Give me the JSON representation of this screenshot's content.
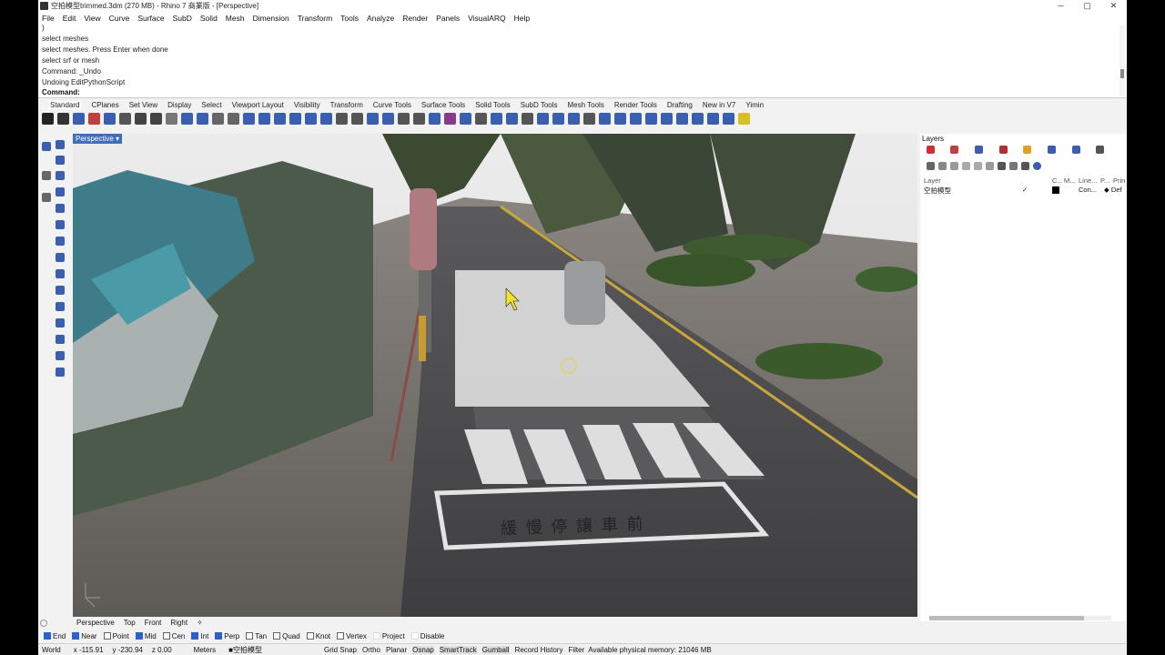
{
  "window": {
    "title": "空拍模型trimmed.3dm (270 MB) - Rhino 7 商業版 - [Perspective]",
    "minimize": "─",
    "maximize": "▢",
    "close": "✕"
  },
  "menu": [
    "File",
    "Edit",
    "View",
    "Curve",
    "Surface",
    "SubD",
    "Solid",
    "Mesh",
    "Dimension",
    "Transform",
    "Tools",
    "Analyze",
    "Render",
    "Panels",
    "VisualARQ",
    "Help"
  ],
  "command_history": [
    ")",
    "select meshes",
    "select meshes. Press Enter when done",
    "select srf or mesh",
    "Command: _Undo",
    "Undoing EditPythonScript"
  ],
  "command_prompt": "Command:",
  "toolbar_tabs": [
    "Standard",
    "CPlanes",
    "Set View",
    "Display",
    "Select",
    "Viewport Layout",
    "Visibility",
    "Transform",
    "Curve Tools",
    "Surface Tools",
    "Solid Tools",
    "SubD Tools",
    "Mesh Tools",
    "Render Tools",
    "Drafting",
    "New in V7",
    "Yimin"
  ],
  "viewport": {
    "label": "Perspective ▾",
    "crosswalk_text": "緩 慢 停 讓 車 前"
  },
  "viewport_tabs": [
    "Perspective",
    "Top",
    "Front",
    "Right",
    "✧"
  ],
  "layers_panel": {
    "title": "Layers",
    "columns": [
      "Layer",
      "C...",
      "M...",
      "Line...",
      "P...",
      "Prin"
    ],
    "rows": [
      {
        "name": "空拍模型",
        "check": "✓",
        "linetype": "Con...",
        "print": "◆ Def"
      }
    ]
  },
  "osnap": [
    {
      "label": "End",
      "checked": true
    },
    {
      "label": "Near",
      "checked": true
    },
    {
      "label": "Point",
      "checked": false
    },
    {
      "label": "Mid",
      "checked": true
    },
    {
      "label": "Cen",
      "checked": false
    },
    {
      "label": "Int",
      "checked": true
    },
    {
      "label": "Perp",
      "checked": true
    },
    {
      "label": "Tan",
      "checked": false
    },
    {
      "label": "Quad",
      "checked": false
    },
    {
      "label": "Knot",
      "checked": false
    },
    {
      "label": "Vertex",
      "checked": false
    },
    {
      "label": "Project",
      "checked": false
    },
    {
      "label": "Disable",
      "checked": false
    }
  ],
  "status": {
    "cplane": "World",
    "x": "x -115.91",
    "y": "y -230.94",
    "z": "z 0.00",
    "units": "Meters",
    "layer": "■空拍模型",
    "grid_snap": "Grid Snap",
    "ortho": "Ortho",
    "planar": "Planar",
    "osnap": "Osnap",
    "smarttrack": "SmartTrack",
    "gumball": "Gumball",
    "record_history": "Record History",
    "filter": "Filter",
    "memory": "Available physical memory: 21046 MB"
  }
}
